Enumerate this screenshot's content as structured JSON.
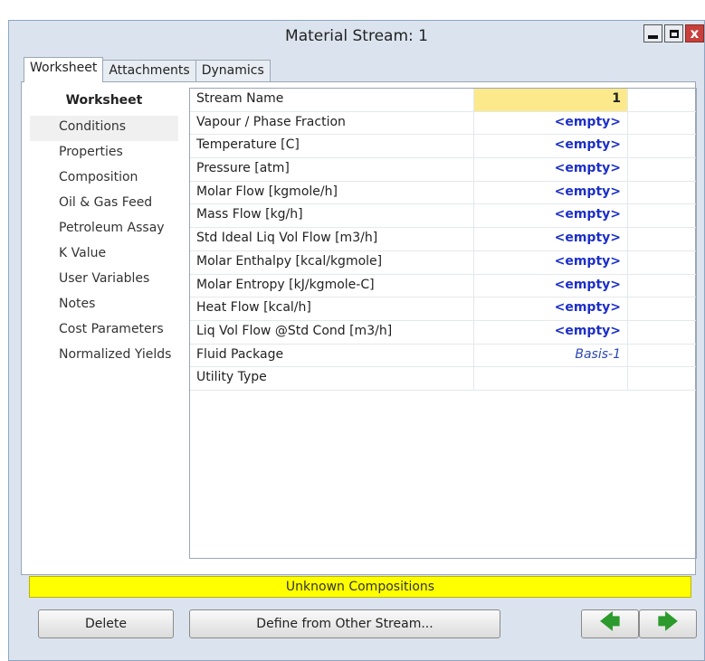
{
  "window": {
    "title": "Material Stream: 1",
    "close_glyph": "x"
  },
  "tabs": [
    "Worksheet",
    "Attachments",
    "Dynamics"
  ],
  "nav": {
    "header": "Worksheet",
    "items": [
      "Conditions",
      "Properties",
      "Composition",
      "Oil & Gas Feed",
      "Petroleum Assay",
      "K Value",
      "User Variables",
      "Notes",
      "Cost Parameters",
      "Normalized Yields"
    ]
  },
  "grid": {
    "rows": [
      {
        "label": "Stream Name",
        "value": "1"
      },
      {
        "label": "Vapour / Phase Fraction",
        "value": "<empty>"
      },
      {
        "label": "Temperature [C]",
        "value": "<empty>"
      },
      {
        "label": "Pressure [atm]",
        "value": "<empty>"
      },
      {
        "label": "Molar Flow [kgmole/h]",
        "value": "<empty>"
      },
      {
        "label": "Mass Flow [kg/h]",
        "value": "<empty>"
      },
      {
        "label": "Std Ideal Liq Vol Flow [m3/h]",
        "value": "<empty>"
      },
      {
        "label": "Molar Enthalpy [kcal/kgmole]",
        "value": "<empty>"
      },
      {
        "label": "Molar Entropy [kJ/kgmole-C]",
        "value": "<empty>"
      },
      {
        "label": "Heat Flow [kcal/h]",
        "value": "<empty>"
      },
      {
        "label": "Liq Vol Flow @Std Cond [m3/h]",
        "value": "<empty>"
      },
      {
        "label": "Fluid Package",
        "value": "Basis-1"
      },
      {
        "label": "Utility Type",
        "value": ""
      }
    ]
  },
  "status": {
    "text": "Unknown Compositions",
    "color": "#ffff00"
  },
  "buttons": {
    "delete": "Delete",
    "define": "Define from Other Stream...",
    "prev_glyph": "🡄",
    "next_glyph": "🡆"
  }
}
